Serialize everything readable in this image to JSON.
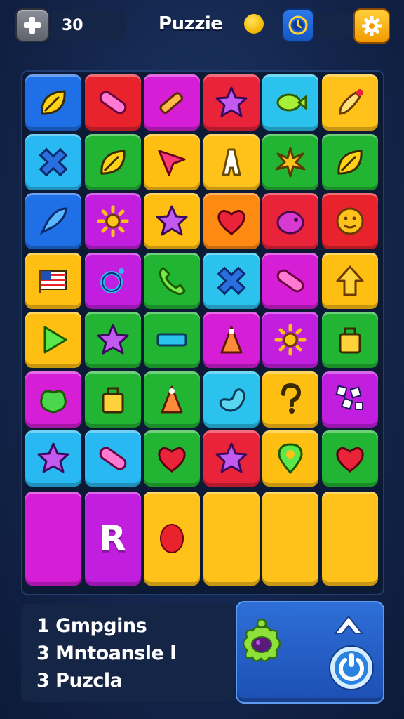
{
  "header": {
    "score": "30",
    "title": "Puzzie",
    "icons": {
      "add": "plus-icon",
      "coin": "coin-icon",
      "timer": "clock-icon",
      "settings": "gear-icon"
    }
  },
  "board": {
    "rows": [
      [
        {
          "color": "#1f6fe6",
          "icon": "leaf-icon"
        },
        {
          "color": "#e8232c",
          "icon": "pill-icon"
        },
        {
          "color": "#d61ed6",
          "icon": "pencil-icon"
        },
        {
          "color": "#e8233a",
          "icon": "star-icon"
        },
        {
          "color": "#2bc3ee",
          "icon": "fish-icon"
        },
        {
          "color": "#ffc21a",
          "icon": "brush-icon"
        }
      ],
      [
        {
          "color": "#29b9f2",
          "icon": "cross-icon"
        },
        {
          "color": "#22b534",
          "icon": "leaf-icon"
        },
        {
          "color": "#ffbf12",
          "icon": "arrow-pointer-icon"
        },
        {
          "color": "#ffc21a",
          "icon": "letter-a-icon"
        },
        {
          "color": "#22b534",
          "icon": "splat-icon"
        },
        {
          "color": "#22b534",
          "icon": "leaf-icon"
        }
      ],
      [
        {
          "color": "#1f6fe6",
          "icon": "rocket-icon"
        },
        {
          "color": "#c21ee0",
          "icon": "sun-icon"
        },
        {
          "color": "#ffbf12",
          "icon": "star-icon"
        },
        {
          "color": "#ff8a12",
          "icon": "heart-icon"
        },
        {
          "color": "#e8233a",
          "icon": "pig-icon"
        },
        {
          "color": "#e8232c",
          "icon": "smiley-icon"
        }
      ],
      [
        {
          "color": "#ffbf12",
          "icon": "flag-icon"
        },
        {
          "color": "#c21ee0",
          "icon": "ring-icon"
        },
        {
          "color": "#22b534",
          "icon": "phone-icon"
        },
        {
          "color": "#2bc3ee",
          "icon": "cross-icon"
        },
        {
          "color": "#d61ed6",
          "icon": "pill-icon"
        },
        {
          "color": "#ffbf12",
          "icon": "arrow-up-icon"
        }
      ],
      [
        {
          "color": "#ffbf12",
          "icon": "play-icon"
        },
        {
          "color": "#22b534",
          "icon": "star-icon"
        },
        {
          "color": "#22b534",
          "icon": "bar-icon"
        },
        {
          "color": "#d61ed6",
          "icon": "cone-icon"
        },
        {
          "color": "#c21ee0",
          "icon": "sun-icon"
        },
        {
          "color": "#22b534",
          "icon": "bag-icon"
        }
      ],
      [
        {
          "color": "#d61ed6",
          "icon": "frog-icon"
        },
        {
          "color": "#22b534",
          "icon": "bag-icon"
        },
        {
          "color": "#22b534",
          "icon": "cone-icon"
        },
        {
          "color": "#2bc3ee",
          "icon": "bean-icon"
        },
        {
          "color": "#ffbf12",
          "icon": "question-icon"
        },
        {
          "color": "#c21ee0",
          "icon": "dice-icon"
        }
      ],
      [
        {
          "color": "#29b9f2",
          "icon": "star-icon"
        },
        {
          "color": "#29b9f2",
          "icon": "pill-icon"
        },
        {
          "color": "#22b534",
          "icon": "heart-icon"
        },
        {
          "color": "#e8233a",
          "icon": "star-icon"
        },
        {
          "color": "#ffbf12",
          "icon": "pin-icon"
        },
        {
          "color": "#22b534",
          "icon": "heart-icon"
        }
      ]
    ],
    "bottom_row": [
      {
        "color": "#d61ed6",
        "text": ""
      },
      {
        "color": "#c21ee0",
        "text": "R"
      },
      {
        "color": "#ffc21a",
        "icon": "balloon-icon"
      },
      {
        "color": "#ffc21a",
        "text": ""
      },
      {
        "color": "#ffc21a",
        "text": ""
      },
      {
        "color": "#ffc21a",
        "text": ""
      }
    ]
  },
  "info": {
    "lines": [
      "1 Gmpgins",
      "3 Mntoansle l",
      "3 Puzcla"
    ]
  },
  "actions": {
    "icons": [
      "monster-icon",
      "arrow-up-icon",
      "power-icon"
    ]
  }
}
